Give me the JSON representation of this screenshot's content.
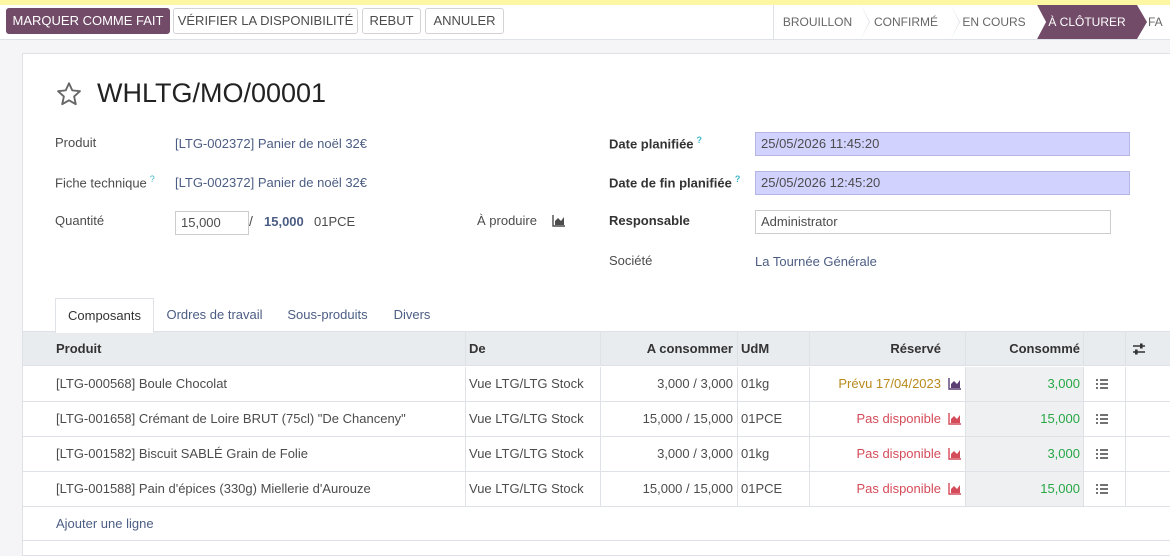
{
  "actions": {
    "mark_done": "MARQUER COMME FAIT",
    "check_availability": "VÉRIFIER LA DISPONIBILITÉ",
    "scrap": "REBUT",
    "cancel": "ANNULER"
  },
  "stages": [
    "BROUILLON",
    "CONFIRMÉ",
    "EN COURS",
    "À CLÔTURER",
    "FA"
  ],
  "active_stage": "À CLÔTURER",
  "colors": {
    "brand": "#714b67",
    "required_field": "#d2d2ff",
    "link": "#4c5d84",
    "success": "#28a745",
    "danger": "#d44c59"
  },
  "record": {
    "title": "WHLTG/MO/00001",
    "product_label": "Produit",
    "product_value": "[LTG-002372] Panier de noël 32€",
    "bom_label": "Fiche technique",
    "bom_help": "?",
    "bom_value": "[LTG-002372] Panier de noël 32€",
    "quantity_label": "Quantité",
    "quantity_value": "15,000",
    "quantity_sep": "/",
    "quantity_total": "15,000",
    "quantity_uom": "01PCE",
    "to_produce_label": "À produire",
    "date_planned_label": "Date planifiée",
    "date_planned_help": "?",
    "date_planned_value": "25/05/2026 11:45:20",
    "date_end_label": "Date de fin planifiée",
    "date_end_help": "?",
    "date_end_value": "25/05/2026 12:45:20",
    "responsible_label": "Responsable",
    "responsible_value": "Administrator",
    "company_label": "Société",
    "company_value": "La Tournée Générale"
  },
  "tabs": [
    "Composants",
    "Ordres de travail",
    "Sous-produits",
    "Divers"
  ],
  "table": {
    "headers": {
      "product": "Produit",
      "from": "De",
      "to_consume": "A consommer",
      "uom": "UdM",
      "reserved": "Réservé",
      "consumed": "Consommé"
    },
    "rows": [
      {
        "product": "[LTG-000568] Boule Chocolat",
        "from": "Vue LTG/LTG Stock",
        "to_consume": "3,000 / 3,000",
        "uom": "01kg",
        "reserved": "Prévu 17/04/2023",
        "reserved_status": "planned",
        "consumed": "3,000"
      },
      {
        "product": "[LTG-001658] Crémant de Loire BRUT (75cl) \"De Chanceny\"",
        "from": "Vue LTG/LTG Stock",
        "to_consume": "15,000 / 15,000",
        "uom": "01PCE",
        "reserved": "Pas disponible",
        "reserved_status": "unavailable",
        "consumed": "15,000"
      },
      {
        "product": "[LTG-001582] Biscuit SABLÉ Grain de Folie",
        "from": "Vue LTG/LTG Stock",
        "to_consume": "3,000 / 3,000",
        "uom": "01kg",
        "reserved": "Pas disponible",
        "reserved_status": "unavailable",
        "consumed": "3,000"
      },
      {
        "product": "[LTG-001588] Pain d'épices (330g) Miellerie d'Aurouze",
        "from": "Vue LTG/LTG Stock",
        "to_consume": "15,000 / 15,000",
        "uom": "01PCE",
        "reserved": "Pas disponible",
        "reserved_status": "unavailable",
        "consumed": "15,000"
      }
    ],
    "add_line": "Ajouter une ligne"
  },
  "icons": {
    "favorite": "star-outline-icon",
    "forecast": "area-chart-icon",
    "detail": "list-icon",
    "optional_columns": "sliders-icon"
  }
}
